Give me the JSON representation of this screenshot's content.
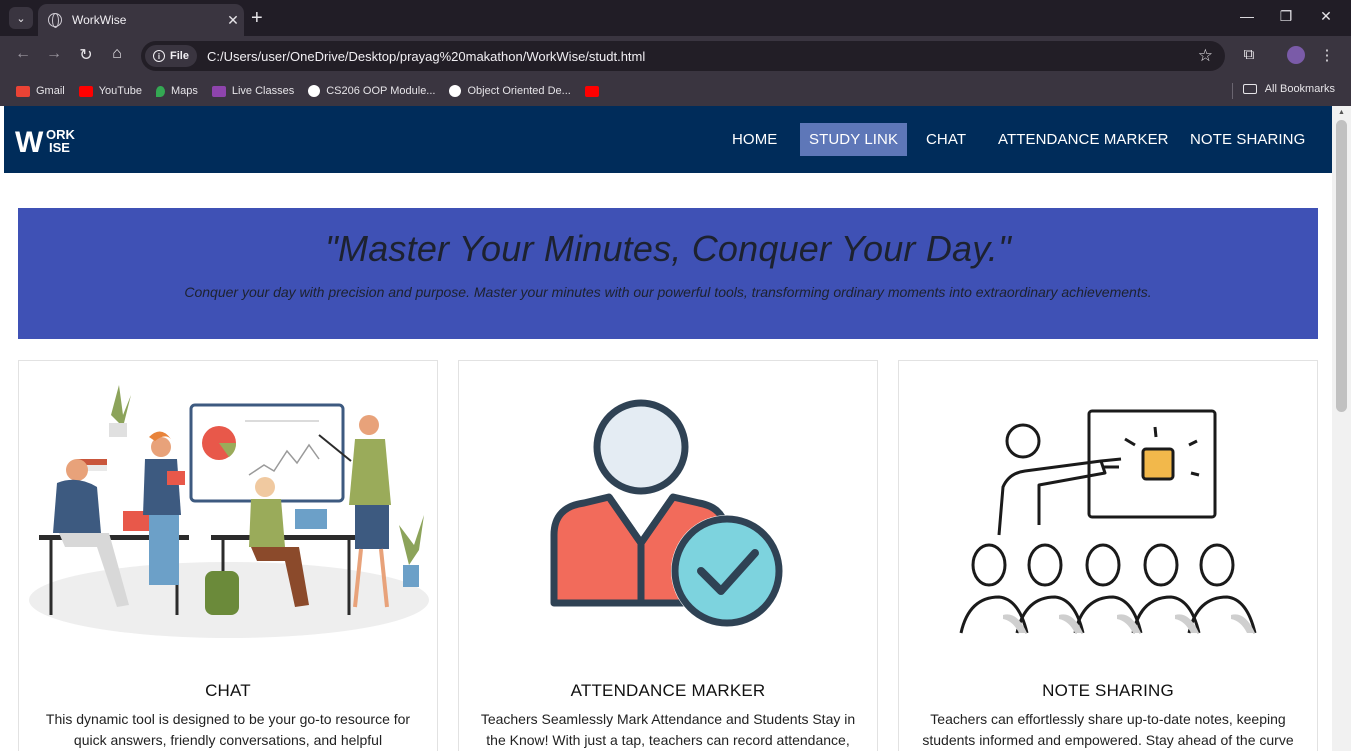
{
  "browser": {
    "tab_title": "WorkWise",
    "tab_close": "✕",
    "new_tab": "+",
    "file_chip": "File",
    "url": "C:/Users/user/OneDrive/Desktop/prayag%20makathon/WorkWise/studt.html",
    "bookmarks": [
      {
        "label": "Gmail",
        "color": "#ea4335"
      },
      {
        "label": "YouTube",
        "color": "#ff0000"
      },
      {
        "label": "Maps",
        "color": "#34a853"
      },
      {
        "label": "Live Classes",
        "color": "#8e44ad"
      },
      {
        "label": "CS206 OOP Module...",
        "color": "#ffffff"
      },
      {
        "label": "Object Oriented De...",
        "color": "#ffffff"
      },
      {
        "label": "",
        "color": "#ff0000"
      }
    ],
    "all_bookmarks": "All Bookmarks"
  },
  "site": {
    "logo_text_top": "ORK",
    "logo_text_bottom": "ISE",
    "logo_letter": "W",
    "nav": [
      {
        "label": "HOME",
        "active": false
      },
      {
        "label": "STUDY LINK",
        "active": true
      },
      {
        "label": "CHAT",
        "active": false
      },
      {
        "label": "ATTENDANCE MARKER",
        "active": false
      },
      {
        "label": "NOTE SHARING",
        "active": false
      }
    ],
    "hero": {
      "title": "\"Master Your Minutes, Conquer Your Day.\"",
      "subtitle": "Conquer your day with precision and purpose. Master your minutes with our powerful tools, transforming ordinary moments into extraordinary achievements."
    },
    "cards": [
      {
        "title": "CHAT",
        "text": "This dynamic tool is designed to be your go-to resource for quick answers, friendly conversations, and helpful"
      },
      {
        "title": "ATTENDANCE MARKER",
        "text": "Teachers Seamlessly Mark Attendance and Students Stay in the Know! With just a tap, teachers can record attendance,"
      },
      {
        "title": "NOTE SHARING",
        "text": "Teachers can effortlessly share up-to-date notes, keeping students informed and empowered. Stay ahead of the curve"
      }
    ]
  },
  "colors": {
    "navbar": "#002c5a",
    "nav_active": "#5e77b8",
    "hero": "#3f51b5"
  }
}
